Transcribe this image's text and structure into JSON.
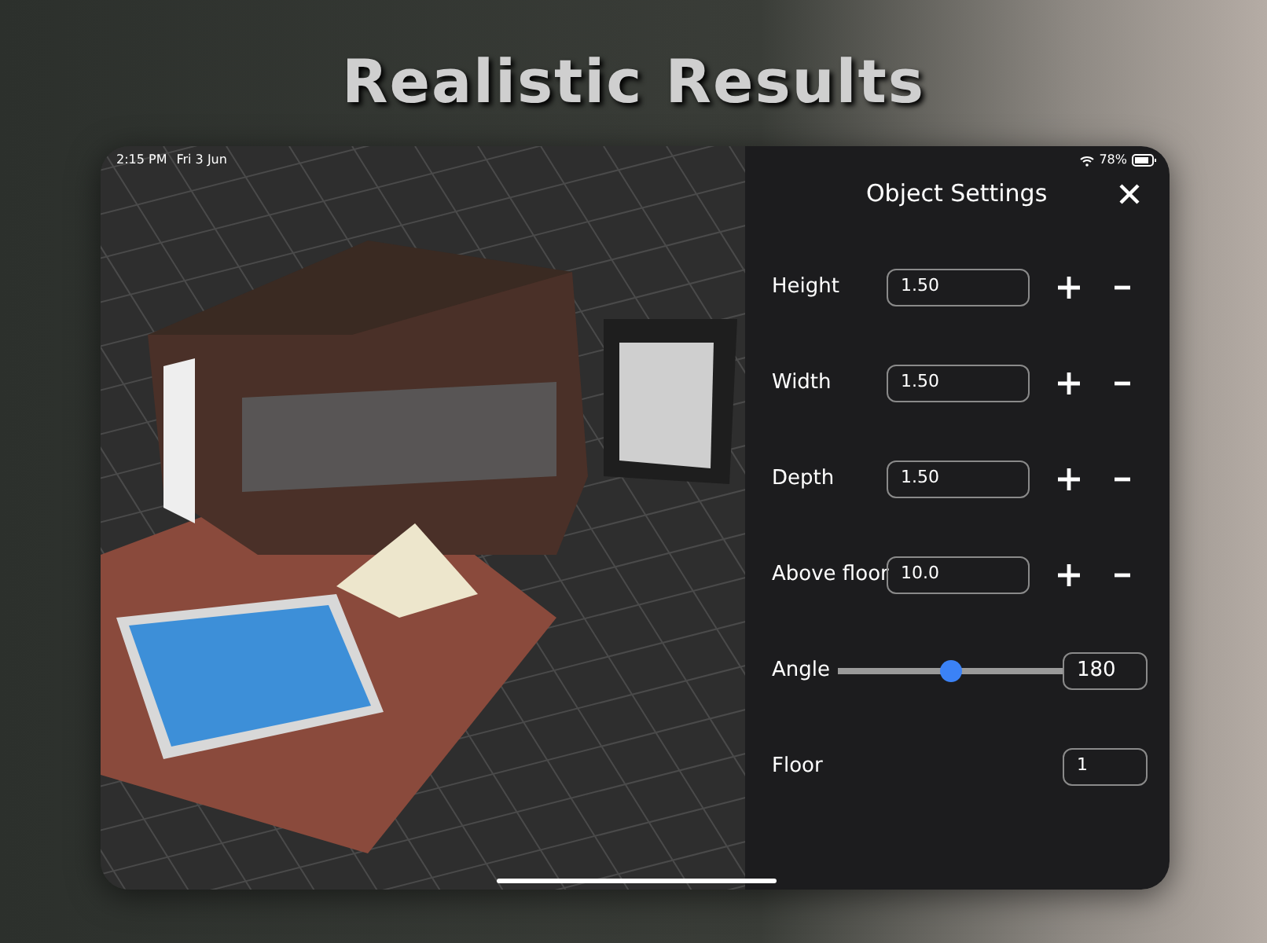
{
  "headline": "Realistic Results",
  "status_bar": {
    "time": "2:15 PM",
    "date": "Fri 3 Jun",
    "battery": "78%"
  },
  "panel": {
    "title": "Object Settings",
    "rows": [
      {
        "kind": "stepper",
        "label": "Height",
        "value": "1.50"
      },
      {
        "kind": "stepper",
        "label": "Width",
        "value": "1.50"
      },
      {
        "kind": "stepper",
        "label": "Depth",
        "value": "1.50"
      },
      {
        "kind": "stepper",
        "label": "Above floor",
        "value": "10.0"
      },
      {
        "kind": "slider",
        "label": "Angle",
        "level": 0.5,
        "value": "180"
      },
      {
        "kind": "field",
        "label": "Floor",
        "value": "1"
      }
    ]
  }
}
